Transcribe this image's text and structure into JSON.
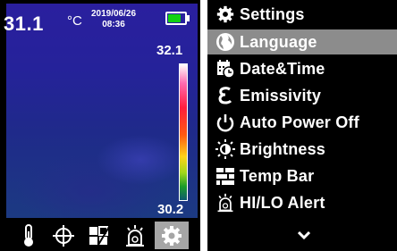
{
  "thermal": {
    "temperature": "31.1",
    "unit": "°C",
    "date": "2019/06/26",
    "time": "08:36",
    "battery_level": 0.8,
    "scale_max": "32.1",
    "scale_min": "30.2"
  },
  "toolbar": [
    {
      "icon": "thermometer-icon"
    },
    {
      "icon": "crosshair-icon"
    },
    {
      "icon": "palette-icon"
    },
    {
      "icon": "alarm-icon"
    },
    {
      "icon": "gear-icon",
      "selected": true
    }
  ],
  "menu": {
    "title": "Settings",
    "items": [
      {
        "label": "Language",
        "icon": "globe-icon",
        "selected": true
      },
      {
        "label": "Date&Time",
        "icon": "calendar-clock-icon"
      },
      {
        "label": "Emissivity",
        "icon": "epsilon-icon"
      },
      {
        "label": "Auto Power Off",
        "icon": "power-icon"
      },
      {
        "label": "Brightness",
        "icon": "brightness-icon"
      },
      {
        "label": "Temp Bar",
        "icon": "temp-bar-icon"
      },
      {
        "label": "HI/LO Alert",
        "icon": "alarm-icon"
      }
    ],
    "more_icon": "chevron-down-icon"
  },
  "colors": {
    "battery": "#12d212",
    "selection": "#8c8c8c",
    "toolbar_selection": "#a6a6a6"
  }
}
